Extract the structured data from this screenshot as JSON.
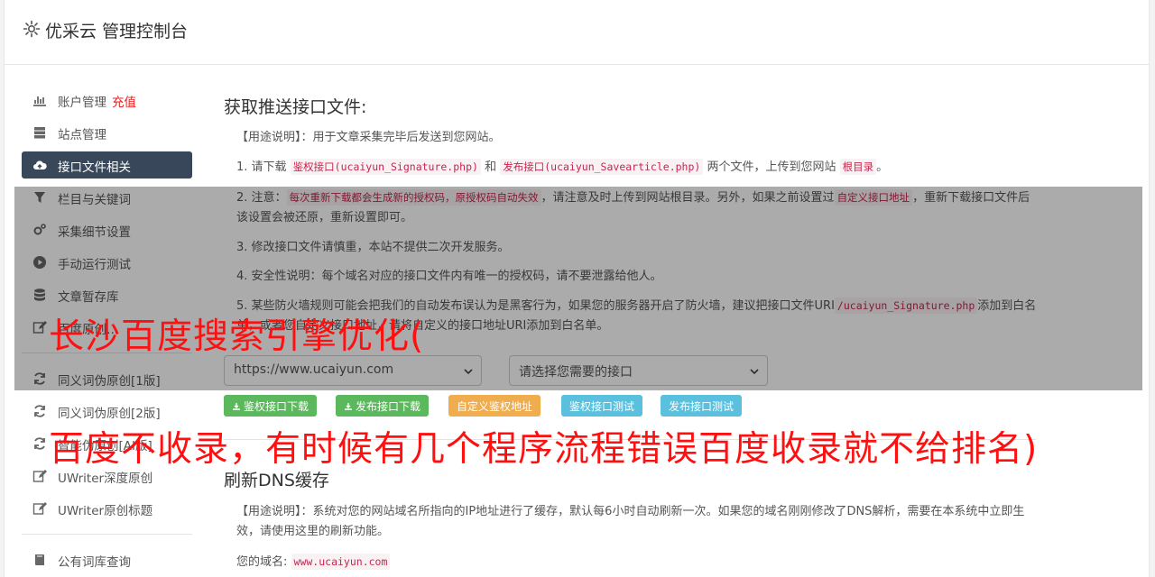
{
  "brand": {
    "title": "优采云 管理控制台",
    "icon": "gear-icon"
  },
  "sidebar": {
    "items": [
      {
        "label": "账户管理",
        "extra": "充值",
        "icon": "bar-chart-icon"
      },
      {
        "label": "站点管理",
        "icon": "server-icon"
      },
      {
        "label": "接口文件相关",
        "icon": "cloud-upload-icon",
        "active": true
      },
      {
        "label": "栏目与关键词",
        "icon": "filter-icon"
      },
      {
        "label": "采集细节设置",
        "icon": "cogs-icon"
      },
      {
        "label": "手动运行测试",
        "icon": "play-circle-icon"
      },
      {
        "label": "文章暂存库",
        "icon": "database-icon"
      },
      {
        "label": "百度原创…",
        "icon": "edit-icon"
      },
      {
        "label": "同义词伪原创[1版]",
        "icon": "refresh-icon"
      },
      {
        "label": "同义词伪原创[2版]",
        "icon": "refresh-icon"
      },
      {
        "label": "智能伪原创[AI版]",
        "icon": "refresh-icon"
      },
      {
        "label": "UWriter深度原创",
        "icon": "edit-icon"
      },
      {
        "label": "UWriter原创标题",
        "icon": "edit-icon"
      },
      {
        "label": "公有词库查询",
        "icon": "book-icon"
      }
    ]
  },
  "section1": {
    "title": "获取推送接口文件:",
    "usage": "【用途说明】：用于文章采集完毕后发送到您网站。",
    "step1": {
      "pre": "1. 请下载",
      "code1": "鉴权接口(ucaiyun_Signature.php)",
      "mid": "和",
      "code2": "发布接口(ucaiyun_Savearticle.php)",
      "post": "两个文件，上传到您网站",
      "code3": "根目录",
      "end": "。"
    },
    "step2": {
      "pre": "2. 注意：",
      "code1": "每次重新下载都会生成新的授权码，原授权码自动失效",
      "mid": "，请注意及时上传到网站根目录。另外，如果之前设置过",
      "code2": "自定义接口地址",
      "post": "，重新下载接口文件后该设置会被还原，重新设置即可。"
    },
    "step3": "3. 修改接口文件请慎重，本站不提供二次开发服务。",
    "step4": "4. 安全性说明：每个域名对应的接口文件内有唯一的授权码，请不要泄露给他人。",
    "step5": {
      "pre": "5. 某些防火墙规则可能会把我们的自动发布误认为是黑客行为，如果您的服务器开启了防火墙，建议把接口文件URI",
      "code1": "/ucaiyun_Signature.php",
      "post": "添加到白名单，或者您自定义接口地址，请将自定义的接口地址URI添加到白名单。"
    },
    "site_select": "https://www.ucaiyun.com",
    "interface_select": "请选择您需要的接口",
    "buttons": {
      "download_auth": "鉴权接口下载",
      "download_publish": "发布接口下载",
      "custom_auth": "自定义鉴权地址",
      "test_auth": "鉴权接口测试",
      "test_publish": "发布接口测试"
    }
  },
  "section2": {
    "title": "刷新DNS缓存",
    "usage": "【用途说明】：系统对您的网站域名所指向的IP地址进行了缓存，默认每6小时自动刷新一次。如果您的域名刚刚修改了DNS解析，需要在本系统中立即生效，请使用这里的刷新功能。",
    "domain_label": "您的域名:",
    "domain_value": "www.ucaiyun.com"
  },
  "watermark": {
    "line1": "长沙百度搜索引擎优化(",
    "line2": "百度不收录，有时候有几个程序流程错误百度收录就不给排名)"
  },
  "colors": {
    "active_bg": "#384759",
    "accent_red": "#e02020",
    "green": "#5cb85c",
    "orange": "#f0ad4e",
    "blue": "#5bc0de"
  }
}
